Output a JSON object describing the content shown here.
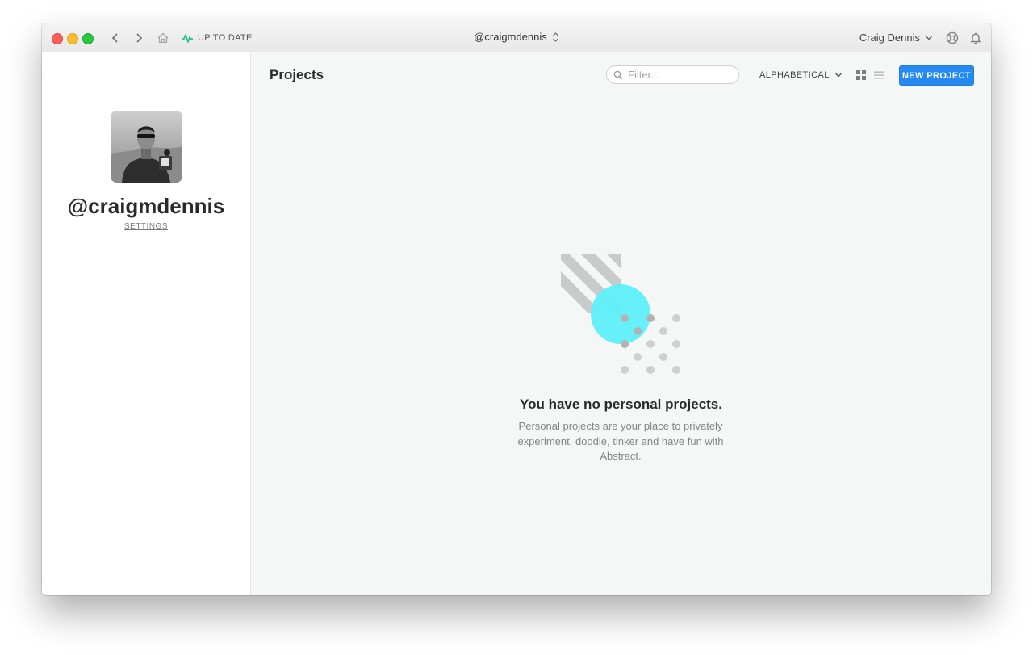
{
  "titlebar": {
    "status_label": "UP TO DATE",
    "account": "@craigmdennis",
    "user_name": "Craig Dennis"
  },
  "sidebar": {
    "username": "@craigmdennis",
    "settings_label": "SETTINGS"
  },
  "main": {
    "title": "Projects",
    "filter_placeholder": "Filter...",
    "sort_label": "ALPHABETICAL",
    "new_project_label": "NEW PROJECT",
    "empty_title": "You have no personal projects.",
    "empty_description": "Personal projects are your place to privately experiment, doodle, tinker and have fun with Abstract."
  },
  "colors": {
    "accent": "#2489f0",
    "status_green": "#1fc08c",
    "illustration_cyan": "#5ef0fa"
  },
  "icons": {
    "back": "chevron-left-icon",
    "forward": "chevron-right-icon",
    "home": "home-icon",
    "status": "activity-pulse-icon",
    "switcher": "up-down-chevron-icon",
    "help": "lifebuoy-icon",
    "notifications": "bell-icon",
    "grid_view": "grid-view-icon",
    "list_view": "list-view-icon"
  }
}
